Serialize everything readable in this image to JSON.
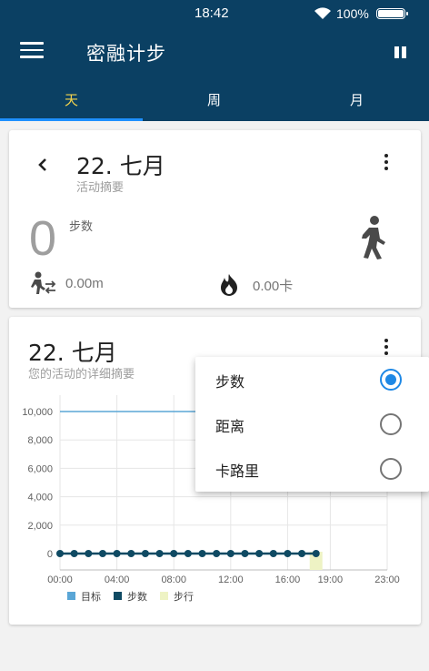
{
  "status_bar": {
    "time": "18:42",
    "battery": "100%"
  },
  "app": {
    "title": "密融计步"
  },
  "tabs": [
    {
      "label": "天",
      "active": true
    },
    {
      "label": "周",
      "active": false
    },
    {
      "label": "月",
      "active": false
    }
  ],
  "summary_card": {
    "date": "22. 七月",
    "subtitle": "活动摘要",
    "steps_value": "0",
    "steps_label": "步数",
    "distance": "0.00m",
    "calories": "0.00卡"
  },
  "detail_card": {
    "date": "22. 七月",
    "subtitle": "您的活动的详细摘要"
  },
  "popup_menu": {
    "items": [
      {
        "label": "步数",
        "checked": true
      },
      {
        "label": "距离",
        "checked": false
      },
      {
        "label": "卡路里",
        "checked": false
      }
    ]
  },
  "colors": {
    "appbar": "#0b4063",
    "tab_active": "#f4d44d",
    "tab_indicator": "#1e90ff",
    "goal_line": "#5aa6d6",
    "steps_series": "#0f4a63",
    "walking_series": "#eef3c4",
    "radio_checked": "#1e88e5"
  },
  "chart_data": {
    "type": "line",
    "x_ticks": [
      "00:00",
      "04:00",
      "08:00",
      "12:00",
      "16:00",
      "19:00",
      "23:00"
    ],
    "y_ticks": [
      "10,000",
      "8,000",
      "6,000",
      "4,000",
      "2,000",
      "0"
    ],
    "ylim": [
      0,
      10000
    ],
    "xlim": [
      0,
      23
    ],
    "series": [
      {
        "name": "目标",
        "color": "#5aa6d6",
        "values": [
          10000,
          10000
        ]
      },
      {
        "name": "步数",
        "color": "#0f4a63",
        "hours": [
          0,
          1,
          2,
          3,
          4,
          5,
          6,
          7,
          8,
          9,
          10,
          11,
          12,
          13,
          14,
          15,
          16,
          17,
          18
        ],
        "values": [
          0,
          0,
          0,
          0,
          0,
          0,
          0,
          0,
          0,
          0,
          0,
          0,
          0,
          0,
          0,
          0,
          0,
          0,
          0
        ]
      },
      {
        "name": "步行",
        "color": "#eef3c4",
        "hours": [
          18
        ],
        "values": [
          0
        ]
      }
    ],
    "legend_position": "bottom-left"
  }
}
